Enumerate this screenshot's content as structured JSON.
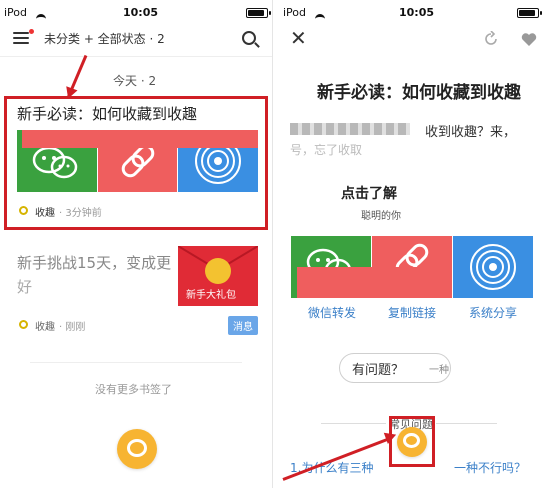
{
  "left": {
    "status": {
      "carrier": "iPod",
      "time": "10:05"
    },
    "toolbar": {
      "filter_label": "未分类 + 全部状态 · 2"
    },
    "section_header": "今天 · 2",
    "cards": [
      {
        "title": "新手必读：如何收藏到收趣",
        "tag": "收趣",
        "time": "· 3分钟前"
      },
      {
        "title_line1": "新手挑战15天，变成更",
        "title_line2": "好",
        "tag": "收趣",
        "time": "· 刚刚",
        "badge": "消息",
        "image_text": "新手大礼包"
      }
    ],
    "footer_text": "没有更多书签了"
  },
  "right": {
    "status": {
      "carrier": "iPod",
      "time": "10:05"
    },
    "article_title": "新手必读：如何收藏到收趣",
    "garbled_line1": "收到收趣？来，",
    "garbled_line2": "号，忘了收取",
    "subheading": "点击了解",
    "subtext": "聪明的你",
    "share_options": [
      "微信转发",
      "复制链接",
      "系统分享"
    ],
    "question_pill": "有问题？",
    "question_pill_tail": "一种",
    "faq_heading": "常见问题",
    "faq_item_start": "1.为什么有三种",
    "faq_item_end": "一种不行吗？"
  }
}
